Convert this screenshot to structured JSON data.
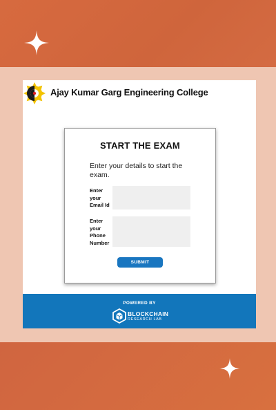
{
  "header": {
    "college_name": "Ajay Kumar Garg Engineering College",
    "logo_icon": "college-emblem-icon"
  },
  "exam_card": {
    "title": "START THE EXAM",
    "description": "Enter your details to start the exam.",
    "email_label": "Enter your Email Id",
    "email_value": "",
    "phone_label": "Enter your Phone Number",
    "phone_value": "",
    "submit_label": "SUBMIT"
  },
  "footer": {
    "powered_by": "POWERED BY",
    "brand_name": "BLOCKCHAIN",
    "brand_subtitle": "RESEARCH LAB",
    "brand_icon": "blockchain-cube-icon"
  },
  "colors": {
    "background": "#d2673f",
    "frame": "#efc6b2",
    "footer": "#1276bb",
    "button": "#1976c0",
    "input_fill": "#efefef"
  },
  "decorations": [
    "sparkle-icon",
    "sparkle-icon"
  ]
}
